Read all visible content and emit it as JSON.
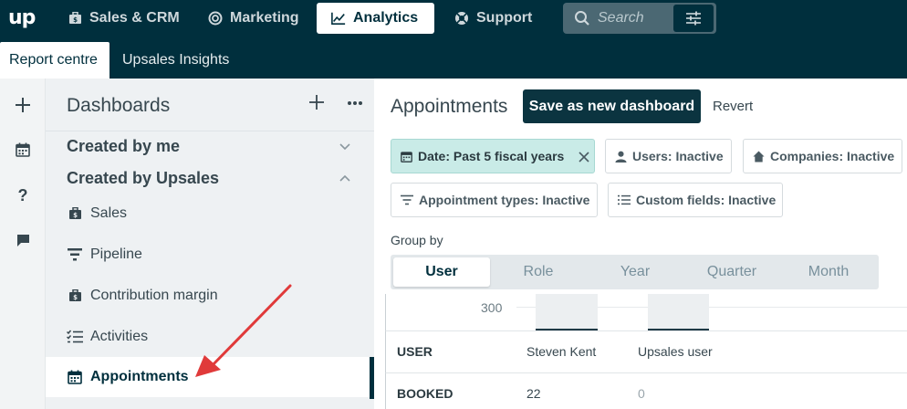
{
  "topbar": {
    "logo": "up",
    "nav": [
      {
        "label": "Sales & CRM",
        "icon": "briefcase-icon"
      },
      {
        "label": "Marketing",
        "icon": "target-icon"
      },
      {
        "label": "Analytics",
        "icon": "trend-chart-icon"
      },
      {
        "label": "Support",
        "icon": "lifebuoy-icon"
      }
    ],
    "active_nav": "Analytics",
    "search_placeholder": "Search"
  },
  "subnav": {
    "tabs": [
      "Report centre",
      "Upsales Insights"
    ],
    "active": "Report centre"
  },
  "rail": [
    "plus-icon",
    "calendar-icon",
    "question-icon",
    "chat-icon"
  ],
  "sidebar": {
    "title": "Dashboards",
    "sections": [
      {
        "label": "Created by me",
        "expanded": false
      },
      {
        "label": "Created by Upsales",
        "expanded": true
      }
    ],
    "items": [
      {
        "label": "Sales",
        "icon": "briefcase-icon"
      },
      {
        "label": "Pipeline",
        "icon": "funnel-icon"
      },
      {
        "label": "Contribution margin",
        "icon": "briefcase-icon"
      },
      {
        "label": "Activities",
        "icon": "checklist-icon"
      },
      {
        "label": "Appointments",
        "icon": "calendar-icon"
      }
    ],
    "active_item": "Appointments"
  },
  "main": {
    "title": "Appointments",
    "save_label": "Save as new dashboard",
    "revert_label": "Revert",
    "filters": [
      {
        "label": "Date: Past 5 fiscal years",
        "icon": "calendar-icon",
        "active": true
      },
      {
        "label": "Users: Inactive",
        "icon": "user-icon"
      },
      {
        "label": "Companies: Inactive",
        "icon": "home-icon"
      },
      {
        "label": "Appointment types: Inactive",
        "icon": "filter-icon"
      },
      {
        "label": "Custom fields: Inactive",
        "icon": "list-icon"
      }
    ],
    "group_by_label": "Group by",
    "group_by_options": [
      "User",
      "Role",
      "Year",
      "Quarter",
      "Month"
    ],
    "group_by_selected": "User"
  },
  "chart_data": {
    "type": "bar",
    "categories": [
      "Steven Kent",
      "Upsales user"
    ],
    "values": [
      22,
      0
    ],
    "y_tick_visible": "300",
    "grid": true
  },
  "table": {
    "header": {
      "label": "USER",
      "cols": [
        "Steven Kent",
        "Upsales user"
      ]
    },
    "rows": [
      {
        "label": "BOOKED",
        "values": [
          "22",
          "0"
        ]
      }
    ]
  },
  "colors": {
    "topbar": "#002f3d",
    "accent": "#0b3440",
    "date_chip": "#c9ebe7",
    "annotation_arrow": "#e03a3a"
  }
}
